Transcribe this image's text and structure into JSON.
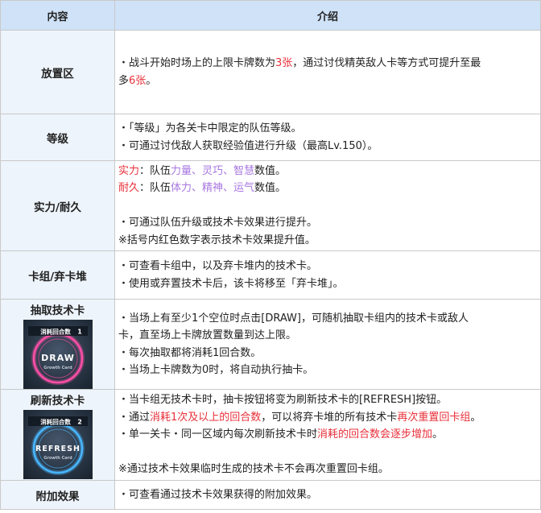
{
  "header": {
    "col1": "内容",
    "col2": "介绍"
  },
  "rows": [
    {
      "key": "放置区",
      "lines": [
        [
          {
            "t": "・战斗开始时场上的上限卡牌数为"
          },
          {
            "t": "3张",
            "c": "red"
          },
          {
            "t": "，通过讨伐精英敌人卡等方式可提升至最"
          }
        ],
        [
          {
            "t": "多"
          },
          {
            "t": "6张",
            "c": "red"
          },
          {
            "t": "。"
          }
        ]
      ]
    },
    {
      "key": "等级",
      "lines": [
        [
          {
            "t": "・「等级」为各关卡中限定的队伍等级。"
          }
        ],
        [
          {
            "t": "・可通过讨伐敌人获取经验值进行升级（最高Lv.150）。"
          }
        ]
      ]
    },
    {
      "key": "实力/耐久",
      "lines": [
        [
          {
            "t": "实力",
            "c": "red"
          },
          {
            "t": "：队伍"
          },
          {
            "t": "力量、灵巧、智慧",
            "c": "purple"
          },
          {
            "t": "数值。"
          }
        ],
        [
          {
            "t": "耐久",
            "c": "red"
          },
          {
            "t": "：队伍"
          },
          {
            "t": "体力、精神、运气",
            "c": "purple"
          },
          {
            "t": "数值。"
          }
        ],
        [],
        [
          {
            "t": "・可通过队伍升级或技术卡效果进行提升。"
          }
        ],
        [
          {
            "t": "※括号内红色数字表示技术卡效果提升值。"
          }
        ]
      ]
    },
    {
      "key": "卡组/弃卡堆",
      "lines": [
        [
          {
            "t": "・可查看卡组中，以及弃卡堆内的技术卡。"
          }
        ],
        [
          {
            "t": "・使用或弃置技术卡后，该卡将移至「弃卡堆」。"
          }
        ]
      ]
    },
    {
      "key": "抽取技术卡",
      "card": {
        "top": "消耗回合数",
        "num": "1",
        "word": "DRAW",
        "sub": "Growth Card",
        "ring": "#ff4fa8"
      },
      "lines": [
        [
          {
            "t": "・当场上有至少1个空位时点击[DRAW]，可随机抽取卡组内的技术卡或敌人"
          }
        ],
        [
          {
            "t": "卡，直至场上卡牌放置数量到达上限。"
          }
        ],
        [
          {
            "t": "・每次抽取都将消耗1回合数。"
          }
        ],
        [
          {
            "t": "・当场上卡牌数为0时，将自动执行抽卡。"
          }
        ]
      ]
    },
    {
      "key": "刷新技术卡",
      "card": {
        "top": "消耗回合数",
        "num": "2",
        "word": "REFRESH",
        "sub": "Growth Card",
        "ring": "#49b6ff"
      },
      "lines": [
        [
          {
            "t": "・当卡组无技术卡时，抽卡按钮将变为刷新技术卡的[REFRESH]按钮。"
          }
        ],
        [
          {
            "t": "・通过"
          },
          {
            "t": "消耗1次及以上的回合数",
            "c": "red"
          },
          {
            "t": "，可以将弃卡堆的所有技术卡"
          },
          {
            "t": "再次重置回卡组",
            "c": "red"
          },
          {
            "t": "。"
          }
        ],
        [
          {
            "t": "・单一关卡・同一区域内每次刷新技术卡时"
          },
          {
            "t": "消耗的回合数会逐步增加",
            "c": "red"
          },
          {
            "t": "。"
          }
        ],
        [],
        [
          {
            "t": "※通过技术卡效果临时生成的技术卡不会再次重置回卡组。"
          }
        ]
      ]
    },
    {
      "key": "附加效果",
      "lines": [
        [
          {
            "t": "・可查看通过技术卡效果获得的附加效果。"
          }
        ]
      ]
    }
  ]
}
